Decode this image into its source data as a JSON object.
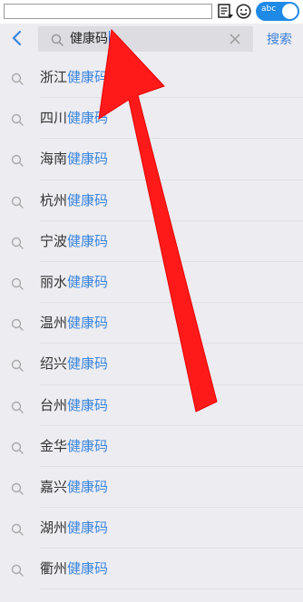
{
  "topbar": {
    "input_value": "",
    "toggle_label": "abc"
  },
  "header": {
    "back_icon": "chevron-left-icon",
    "search_value": "健康码",
    "clear_icon": "close-icon",
    "search_button": "搜索"
  },
  "suggestions": [
    {
      "prefix": "浙江",
      "keyword": "健康码"
    },
    {
      "prefix": "四川",
      "keyword": "健康码"
    },
    {
      "prefix": "海南",
      "keyword": "健康码"
    },
    {
      "prefix": "杭州",
      "keyword": "健康码"
    },
    {
      "prefix": "宁波",
      "keyword": "健康码"
    },
    {
      "prefix": "丽水",
      "keyword": "健康码"
    },
    {
      "prefix": "温州",
      "keyword": "健康码"
    },
    {
      "prefix": "绍兴",
      "keyword": "健康码"
    },
    {
      "prefix": "台州",
      "keyword": "健康码"
    },
    {
      "prefix": "金华",
      "keyword": "健康码"
    },
    {
      "prefix": "嘉兴",
      "keyword": "健康码"
    },
    {
      "prefix": "湖州",
      "keyword": "健康码"
    },
    {
      "prefix": "衢州",
      "keyword": "健康码"
    }
  ],
  "colors": {
    "accent": "#3a86dd",
    "annotation_arrow": "#ff1a1a"
  }
}
